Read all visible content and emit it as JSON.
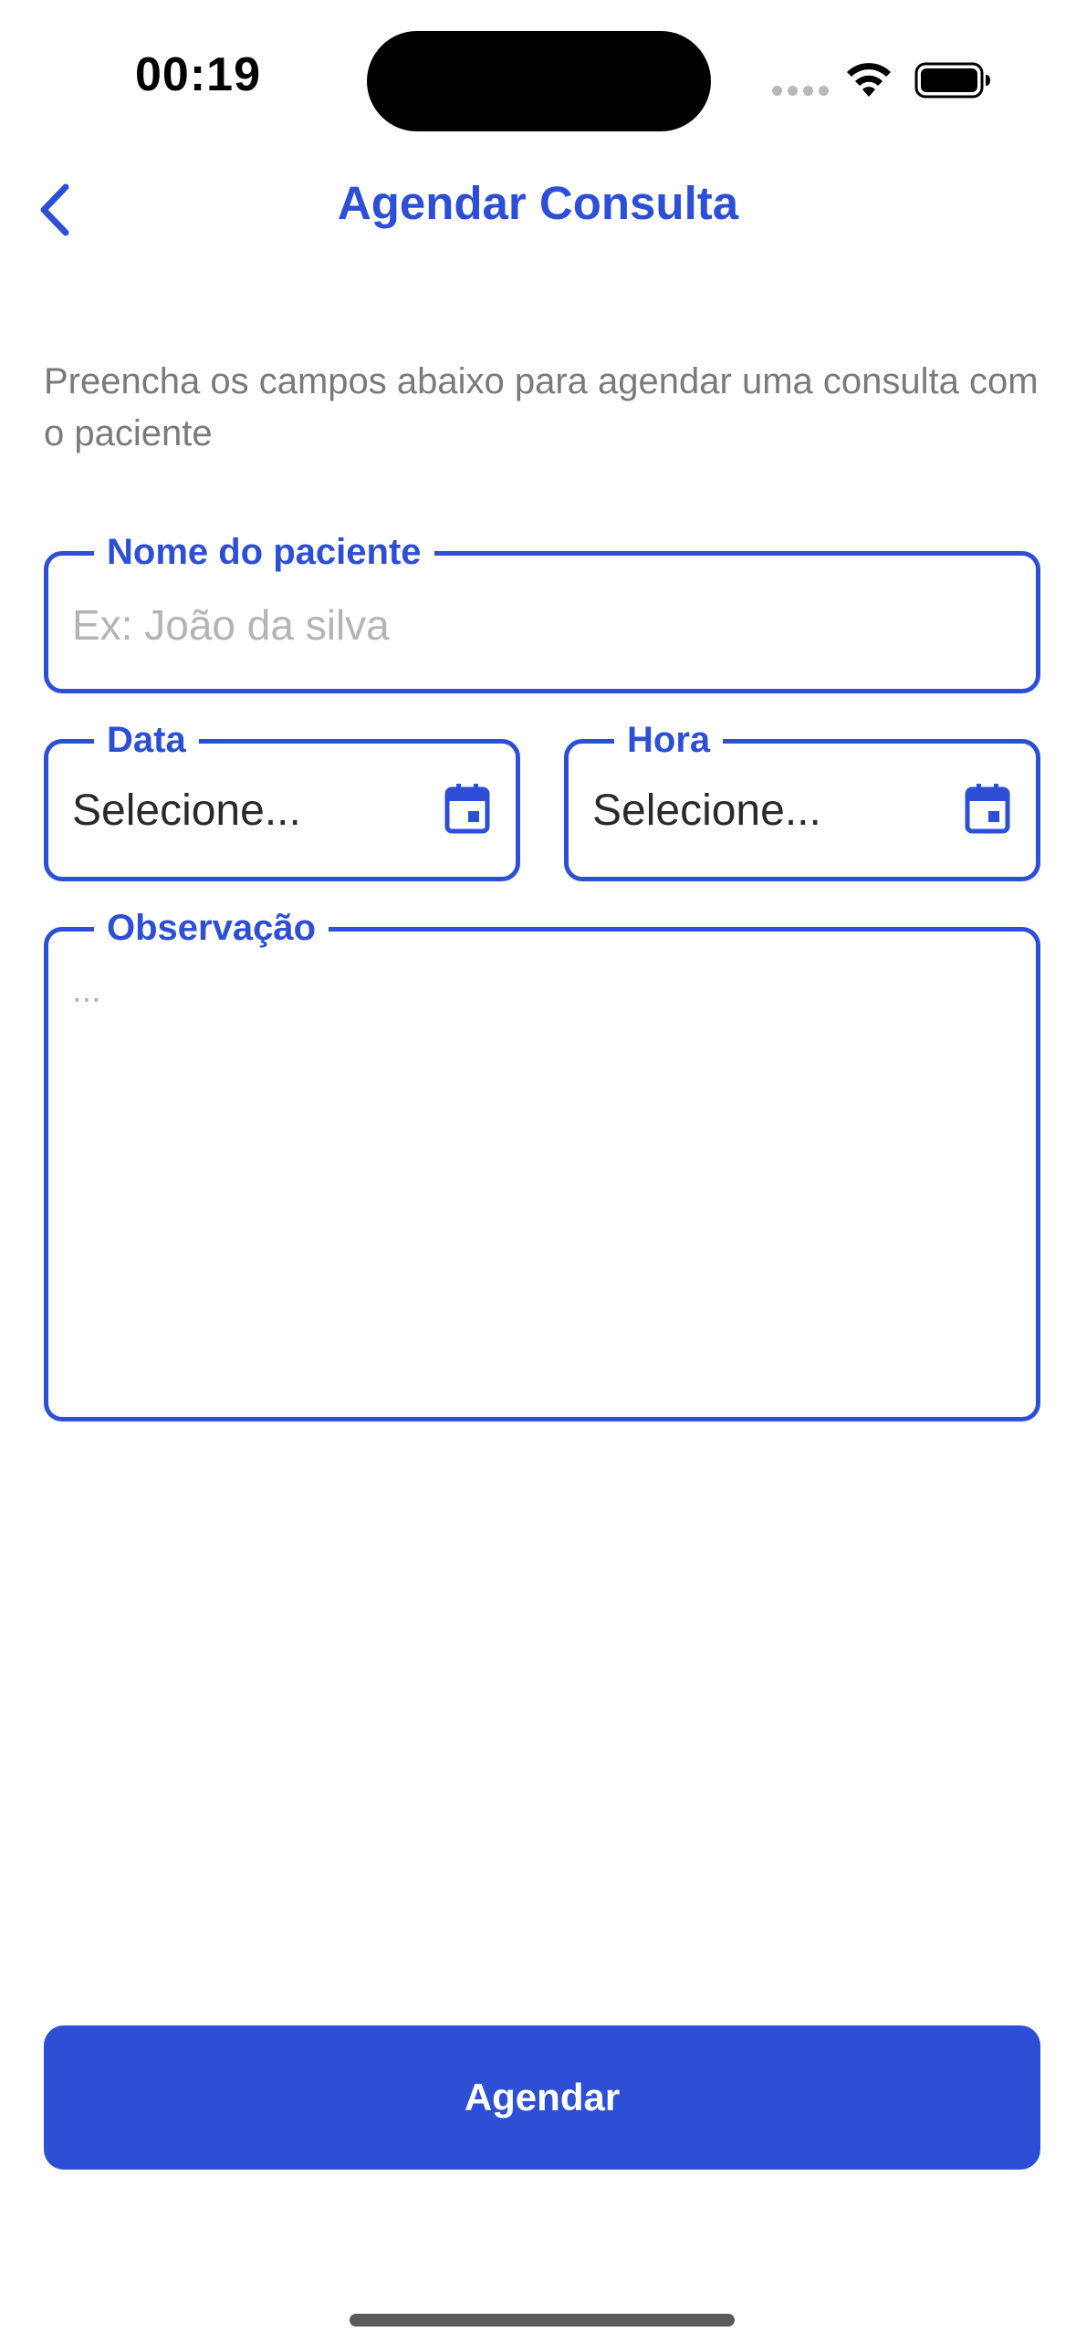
{
  "status_bar": {
    "time": "00:19",
    "icons": [
      "signal-dots-icon",
      "wifi-icon",
      "battery-icon"
    ]
  },
  "header": {
    "back_icon": "chevron-left-icon",
    "title": "Agendar Consulta"
  },
  "description": "Preencha os campos abaixo para agendar uma consulta com o paciente",
  "form": {
    "patient_name": {
      "label": "Nome do paciente",
      "placeholder": "Ex: João da silva",
      "value": ""
    },
    "date": {
      "label": "Data",
      "value": "Selecione...",
      "icon": "calendar-icon"
    },
    "time": {
      "label": "Hora",
      "value": "Selecione...",
      "icon": "calendar-icon"
    },
    "observation": {
      "label": "Observação",
      "placeholder": "...",
      "value": ""
    }
  },
  "submit_label": "Agendar",
  "colors": {
    "accent": "#2d4fd6",
    "description_text": "#7a7a7a",
    "placeholder_text": "#b4b4b4",
    "background": "#ffffff"
  }
}
